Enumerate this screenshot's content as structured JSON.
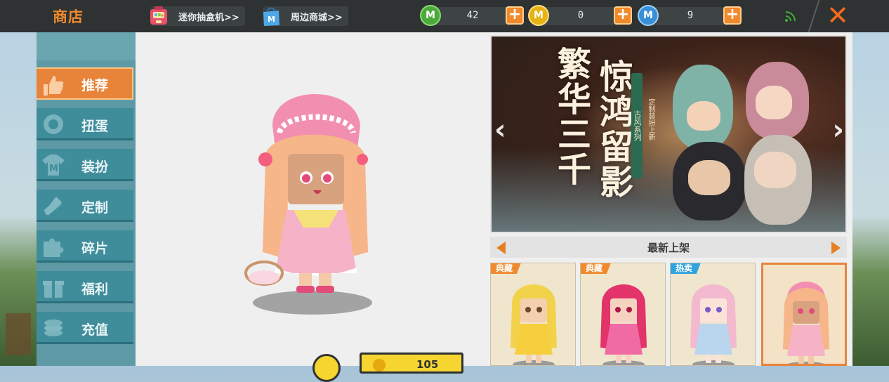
{
  "header": {
    "title": "商店",
    "links": [
      {
        "label": "迷你抽盒机>>",
        "icon": "gacha-machine-icon"
      },
      {
        "label": "周边商城>>",
        "icon": "shopping-bag-icon"
      }
    ],
    "currencies": [
      {
        "icon": "green-mini-coin-icon",
        "value": "42",
        "color": "#4caa3a"
      },
      {
        "icon": "gold-mini-coin-icon",
        "value": "0",
        "color": "#e7b313"
      },
      {
        "icon": "blue-mini-coin-icon",
        "value": "9",
        "color": "#3a8fd8"
      }
    ],
    "close_label": "✕"
  },
  "sidebar": {
    "tabs": [
      {
        "label": "推荐",
        "icon": "thumbs-up-icon",
        "active": true
      },
      {
        "label": "扭蛋",
        "icon": "capsule-icon"
      },
      {
        "label": "装扮",
        "icon": "outfit-icon"
      },
      {
        "label": "定制",
        "icon": "pencil-ruler-icon"
      },
      {
        "label": "碎片",
        "icon": "puzzle-icon"
      },
      {
        "label": "福利",
        "icon": "gift-icon"
      },
      {
        "label": "充值",
        "icon": "coins-icon"
      }
    ]
  },
  "preview": {
    "price": "105",
    "bottom_icon": "coin-icon"
  },
  "banner": {
    "title_line1": "繁华三千",
    "title_line2": "惊鸿留影",
    "series_tag": "古风系列",
    "subtitle": "定制装扮上新"
  },
  "new_arrivals": {
    "title": "最新上架",
    "items": [
      {
        "tag": "典藏",
        "tag_color": "#f08a2c",
        "hair": "#f2d24a",
        "dress": "#f6cf3f"
      },
      {
        "tag": "典藏",
        "tag_color": "#f08a2c",
        "hair": "#e2336a",
        "dress": "#f06aa4"
      },
      {
        "tag": "热卖",
        "tag_color": "#2fa3e0",
        "hair": "#f3b9cf",
        "dress": "#b9d6ee"
      },
      {
        "tag": "",
        "tag_color": "",
        "hair": "#f7b58a",
        "dress": "#f6b3c8",
        "selected": true
      }
    ]
  }
}
